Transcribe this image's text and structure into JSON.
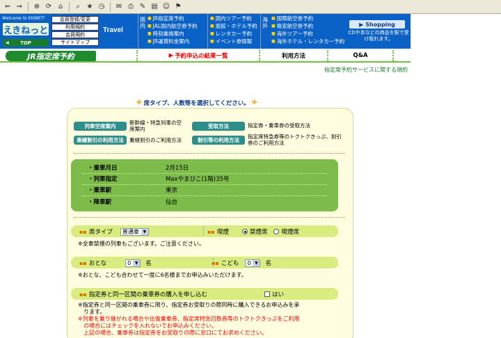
{
  "toolbar": {
    "icons": [
      "back-icon",
      "forward-icon",
      "stop-icon",
      "refresh-icon",
      "home-icon",
      "search-icon",
      "favorites-icon",
      "history-icon",
      "mail-icon",
      "print-icon",
      "edit-icon",
      "discuss-icon",
      "messenger-icon",
      "research-icon"
    ]
  },
  "header": {
    "welcome": "Welcome to EKINET!",
    "logo": "えきねっと",
    "top_label": "TOP",
    "mini_links": [
      "会員登録/変更",
      "利用規約",
      "会員規約",
      "サイトマップ"
    ],
    "travel": "Travel",
    "group_domestic": "国内",
    "group_overseas": "海外",
    "col1": [
      "JR指定席予約",
      "JAL国内航空券予約",
      "時刻乗換案内",
      "JR運賃料金案内"
    ],
    "col2": [
      "国内ツアー予約",
      "旅館・ホテル予約",
      "レンタカー予約",
      "イベント券情報"
    ],
    "col3": [
      "国際航空券予約",
      "格安航空券予約",
      "海外ツアー予約",
      "海外ホテル・レンタカー予約"
    ],
    "shopping": "Shopping",
    "shopping_note": "CDや本などの商品を駅で受け取れます。"
  },
  "title": {
    "jr": "JR指定席予約",
    "tabs": [
      {
        "label": "予約申込の結果一覧",
        "active": true
      },
      {
        "label": "利用方法",
        "active": false
      },
      {
        "label": "Q&A",
        "active": false
      }
    ]
  },
  "rules_link": "指定席予約サービスに関する規約",
  "heading": "席タイプ、人数等を選択してください。",
  "info": {
    "vacancy_btn": "列車空席案内",
    "vacancy_desc": "新幹線・特急列車の空席案内",
    "receipt_btn": "受取方法",
    "receipt_desc": "指定券・乗車券の受取方法",
    "transfer_btn": "乗継割引の利用方法",
    "transfer_desc": "乗継割引のご利用方法",
    "discount_btn": "割引等の利用方法",
    "discount_desc": "指定席特急券等のトクトクきっぷ、割引券のご利用方法"
  },
  "journey": {
    "date_label": "・乗車月日",
    "date": "2月15日",
    "train_label": "・列車指定",
    "train": "Maxやまびこ(1階)35号",
    "from_label": "・乗車駅",
    "from": "東京",
    "to_label": "・降車駅",
    "to": "仙台"
  },
  "seat": {
    "type_label": "席タイプ",
    "type_value": "普通車",
    "smoke_label": "喫煙",
    "non_smoking": "禁煙席",
    "smoking": "喫煙席",
    "note": "※全車禁煙の列車もございます。ご注意ください。"
  },
  "people": {
    "adult_label": "おとな",
    "adult_value": "0",
    "adult_unit": "名",
    "child_label": "こども",
    "child_value": "0",
    "child_unit": "名",
    "note": "※おとな、こども合わせて一度に6名様までお申込みいただけます。"
  },
  "ticket": {
    "label": "指定券と同一区間の乗車券の購入を申し込む",
    "yes": "はい",
    "note1": "※指定券と同一区間の乗車券に限り、指定券お受取りの際同時に購入できるお申込みを承",
    "note2": "ります。",
    "red1": "※列車を乗り継がれる場合や往復乗車券、指定席特急回数券等のトクトクきっぷをご利用",
    "red2": "の場合にはチェックを入れないでお申込みください。",
    "note3": "上記の場合、乗車券は指定券をお受取りの際に窓口にてお求めください。"
  }
}
